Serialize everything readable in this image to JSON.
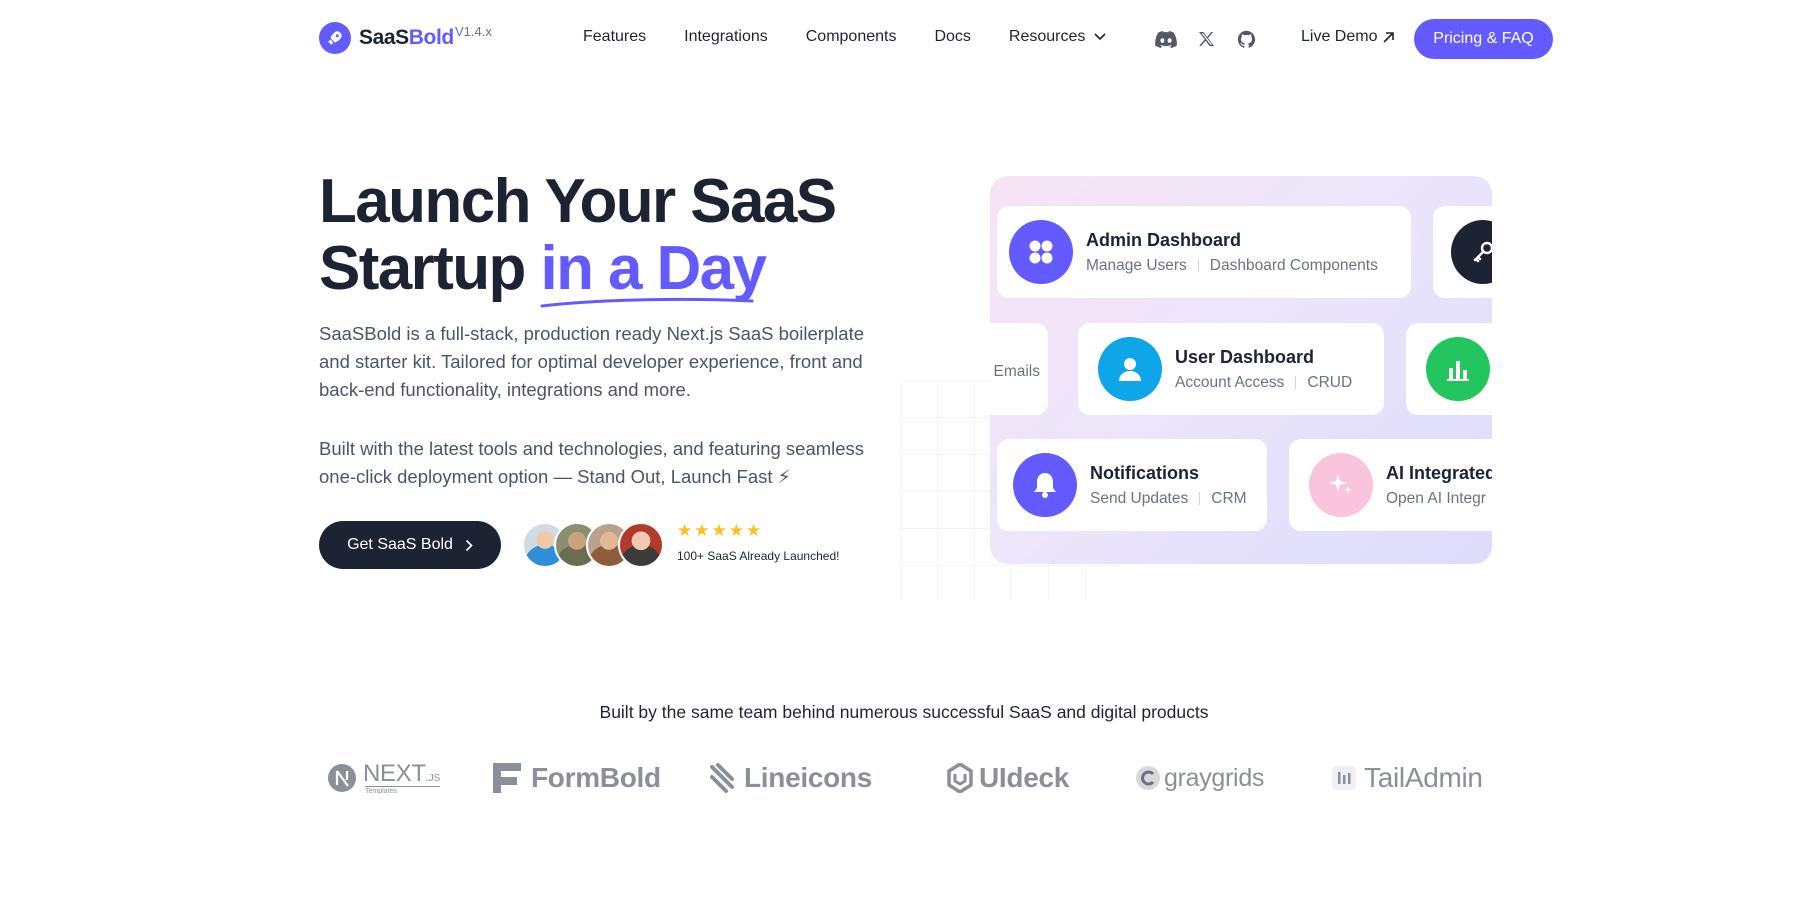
{
  "header": {
    "logo": {
      "brand_main": "SaaS",
      "brand_accent": "Bold",
      "version": "V1.4.x"
    },
    "nav": [
      {
        "label": "Features"
      },
      {
        "label": "Integrations"
      },
      {
        "label": "Components"
      },
      {
        "label": "Docs"
      },
      {
        "label": "Resources"
      }
    ],
    "socials": [
      "discord-icon",
      "x-twitter-icon",
      "github-icon"
    ],
    "live_demo": "Live Demo",
    "cta": "Pricing & FAQ"
  },
  "hero": {
    "title_line1": "Launch Your SaaS",
    "title_line2_plain": "Startup ",
    "title_line2_accent": "in a Day",
    "description": "SaaSBold is a full-stack, production ready Next.js SaaS boilerplate and starter kit. Tailored for optimal developer experience, front and back-end functionality, integrations and more.",
    "description2": "Built with the latest tools and technologies, and featuring seamless one-click deployment option — Stand Out, Launch Fast ⚡",
    "cta": "Get SaaS Bold",
    "rating_stars": 5,
    "social_proof": "100+ SaaS Already Launched!"
  },
  "features_panel": {
    "cards": [
      {
        "title": "Admin Dashboard",
        "sub1": "Manage Users",
        "sub2": "Dashboard Components",
        "icon": "grid-icon",
        "color": "#635bff"
      },
      {
        "title": "",
        "sub1": "",
        "sub2": "",
        "icon": "key-icon",
        "color": "#1c2434"
      },
      {
        "title": "",
        "sub1": "Emails",
        "sub2": "",
        "icon": "",
        "color": ""
      },
      {
        "title": "User Dashboard",
        "sub1": "Account Access",
        "sub2": "CRUD",
        "icon": "user-icon",
        "color": "#0ea5e9"
      },
      {
        "title": "",
        "sub1": "",
        "sub2": "",
        "icon": "bar-chart-icon",
        "color": "#22c55e"
      },
      {
        "title": "Notifications",
        "sub1": "Send Updates",
        "sub2": "CRM",
        "icon": "bell-icon",
        "color": "#635bff"
      },
      {
        "title": "AI Integrated",
        "sub1": "Open AI Integr",
        "sub2": "",
        "icon": "sparkle-icon",
        "color": "#f9a8d4"
      }
    ]
  },
  "brands": {
    "title": "Built by the same team behind numerous successful SaaS and digital products",
    "items": [
      {
        "name": "NEXT",
        "suffix": ".JS",
        "tagline": "Templates",
        "icon": "nextjs-templates-logo"
      },
      {
        "name": "FormBold",
        "icon": "formbold-logo"
      },
      {
        "name": "Lineicons",
        "icon": "lineicons-logo"
      },
      {
        "name": "UIdeck",
        "icon": "uideck-logo"
      },
      {
        "name": "graygrids",
        "icon": "graygrids-logo"
      },
      {
        "name": "TailAdmin",
        "icon": "tailadmin-logo"
      }
    ]
  }
}
